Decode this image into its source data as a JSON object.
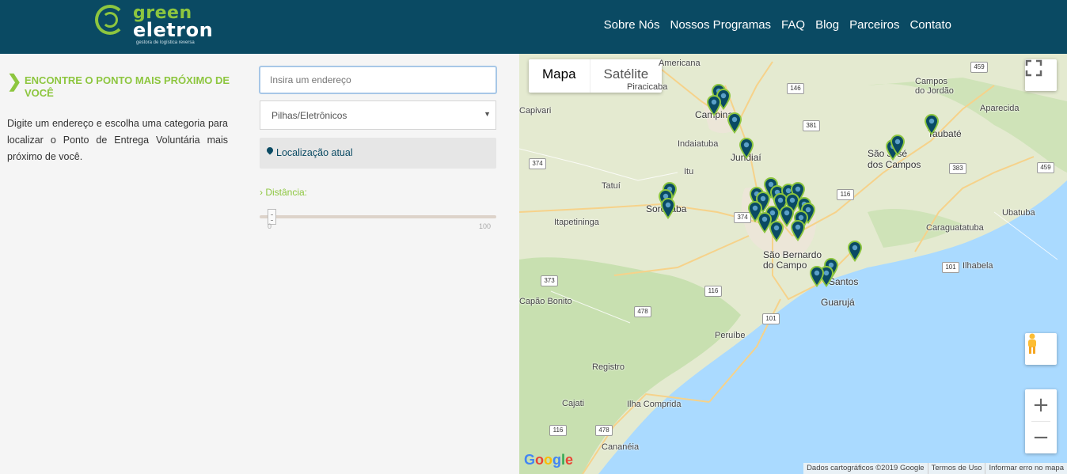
{
  "logo": {
    "line1": "green",
    "line2": "eletron",
    "tagline": "gestora de logística reversa"
  },
  "nav": {
    "items": [
      "Sobre Nós",
      "Nossos Programas",
      "FAQ",
      "Blog",
      "Parceiros",
      "Contato"
    ]
  },
  "finder": {
    "title": "ENCONTRE O PONTO MAIS PRÓXIMO DE VOCÊ",
    "description": "Digite um endereço e escolha uma categoria para localizar o Ponto de Entrega Voluntária mais próximo de você.",
    "address_placeholder": "Insira um endereço",
    "category_selected": "Pilhas/Eletrônicos",
    "current_location": "Localização atual",
    "distance_label": "› Distância:",
    "distance_min": "0",
    "distance_max": "100",
    "distance_value": 0.05
  },
  "map": {
    "type_map": "Mapa",
    "type_satellite": "Satélite",
    "zoom_in": "+",
    "zoom_out": "−",
    "google": "Google",
    "footer": [
      "Dados cartográficos ©2019 Google",
      "Termos de Uso",
      "Informar erro no mapa"
    ],
    "places": [
      "Campinas",
      "Jundiaí",
      "Indaiatuba",
      "Itu",
      "Tatuí",
      "Sorocaba",
      "Itapetininga",
      "São José dos Campos",
      "Taubaté",
      "Campos do Jordão",
      "Aparecida",
      "Ubatuba",
      "Caraguatatuba",
      "Ilhabela",
      "São Bernardo do Campo",
      "Santos",
      "Guarujá",
      "Peruíbe",
      "Registro",
      "Cajati",
      "Ilha Comprida",
      "Cananéia",
      "Piracicaba",
      "Americana",
      "Capão Bonito",
      "Capivari"
    ],
    "roads": [
      "459",
      "146",
      "381",
      "374",
      "116",
      "383",
      "459",
      "373",
      "116",
      "478",
      "101",
      "101",
      "116",
      "478",
      "374"
    ]
  },
  "colors": {
    "header": "#0a4a63",
    "accent": "#8dc63f",
    "marker": "#0a4a63"
  }
}
